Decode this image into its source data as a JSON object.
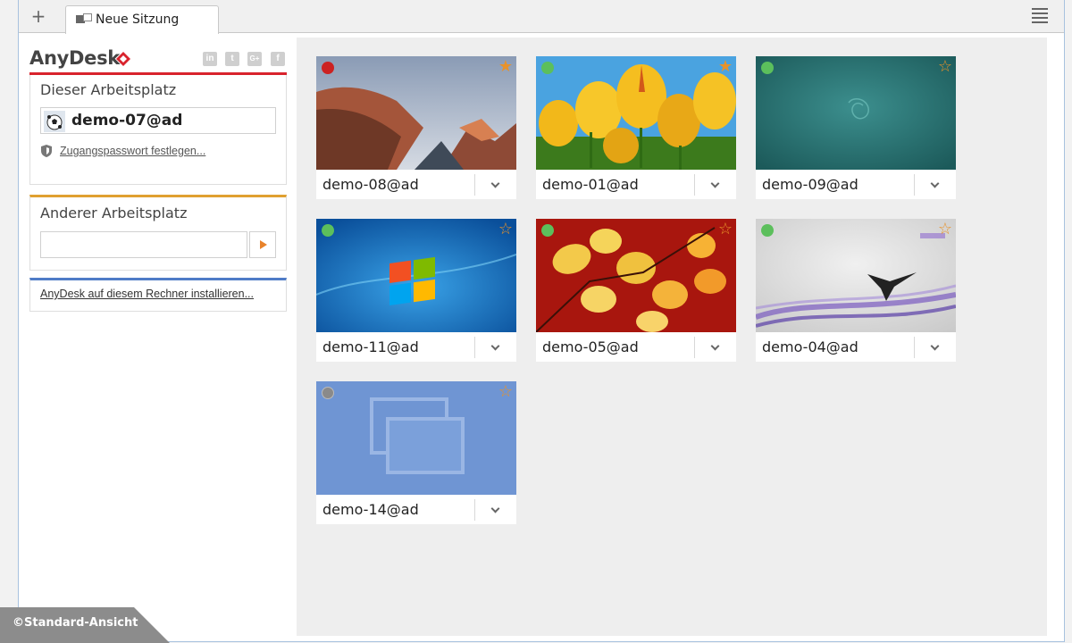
{
  "tabs": [
    {
      "label": "Neue Sitzung"
    }
  ],
  "brand": {
    "name": "AnyDesk",
    "social": [
      "in",
      "t",
      "G+",
      "f"
    ]
  },
  "this_workplace": {
    "title": "Dieser Arbeitsplatz",
    "id": "demo-07@ad",
    "set_password_link": "Zugangspasswort festlegen..."
  },
  "other_workplace": {
    "title": "Anderer Arbeitsplatz",
    "input_value": ""
  },
  "install_link": "AnyDesk auf diesem Rechner installieren...",
  "sessions": [
    {
      "label": "demo-08@ad",
      "status": "offline-red",
      "favorite": true,
      "wallpaper": "mountain"
    },
    {
      "label": "demo-01@ad",
      "status": "online",
      "favorite": true,
      "wallpaper": "tulips"
    },
    {
      "label": "demo-09@ad",
      "status": "online",
      "favorite": false,
      "wallpaper": "debian"
    },
    {
      "label": "demo-11@ad",
      "status": "online",
      "favorite": false,
      "wallpaper": "windows7"
    },
    {
      "label": "demo-05@ad",
      "status": "online",
      "favorite": false,
      "wallpaper": "leaves"
    },
    {
      "label": "demo-04@ad",
      "status": "online",
      "favorite": false,
      "wallpaper": "bird"
    },
    {
      "label": "demo-14@ad",
      "status": "unknown",
      "favorite": false,
      "wallpaper": "placeholder"
    }
  ],
  "colors": {
    "accent_red": "#d9232d",
    "accent_orange": "#e0a030",
    "accent_blue": "#4f7cc7",
    "online": "#5cbf5c",
    "offline": "#cc2222",
    "unknown": "#8a8a8a",
    "star": "#e8922a"
  },
  "footer_watermark": "©Standard-Ansicht"
}
